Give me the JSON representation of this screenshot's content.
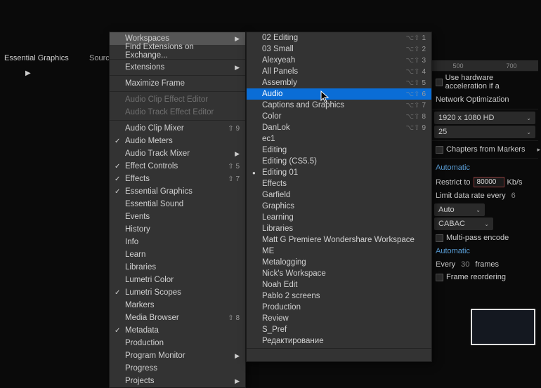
{
  "topPanel": {
    "essentialGraphics": "Essential Graphics",
    "source": "Source: (no cli"
  },
  "menu1": [
    {
      "label": "Workspaces",
      "arrow": true,
      "hl": true
    },
    {
      "label": "Find Extensions on Exchange..."
    },
    {
      "sep": true
    },
    {
      "label": "Extensions",
      "arrow": true
    },
    {
      "sep": true
    },
    {
      "label": "Maximize Frame"
    },
    {
      "sep": true
    },
    {
      "label": "Audio Clip Effect Editor",
      "dis": true
    },
    {
      "label": "Audio Track Effect Editor",
      "dis": true
    },
    {
      "sep": true
    },
    {
      "label": "Audio Clip Mixer",
      "sc": "⇧ 9"
    },
    {
      "label": "Audio Meters",
      "check": true
    },
    {
      "label": "Audio Track Mixer",
      "arrow": true
    },
    {
      "label": "Effect Controls",
      "check": true,
      "sc": "⇧ 5"
    },
    {
      "label": "Effects",
      "check": true,
      "sc": "⇧ 7"
    },
    {
      "label": "Essential Graphics",
      "check": true
    },
    {
      "label": "Essential Sound"
    },
    {
      "label": "Events"
    },
    {
      "label": "History"
    },
    {
      "label": "Info"
    },
    {
      "label": "Learn"
    },
    {
      "label": "Libraries"
    },
    {
      "label": "Lumetri Color"
    },
    {
      "label": "Lumetri Scopes",
      "check": true
    },
    {
      "label": "Markers"
    },
    {
      "label": "Media Browser",
      "sc": "⇧ 8"
    },
    {
      "label": "Metadata",
      "check": true
    },
    {
      "label": "Production"
    },
    {
      "label": "Program Monitor",
      "arrow": true
    },
    {
      "label": "Progress"
    },
    {
      "label": "Projects",
      "arrow": true
    }
  ],
  "menu2": [
    {
      "label": "02 Editing",
      "sc": "1"
    },
    {
      "label": "03 Small",
      "sc": "2"
    },
    {
      "label": "Alexyeah",
      "sc": "3"
    },
    {
      "label": "All Panels",
      "sc": "4"
    },
    {
      "label": "Assembly",
      "sc": "5"
    },
    {
      "label": "Audio",
      "sc": "6",
      "sel": true
    },
    {
      "label": "Captions and Graphics",
      "sc": "7"
    },
    {
      "label": "Color",
      "sc": "8"
    },
    {
      "label": "DanLok",
      "sc": "9"
    },
    {
      "label": "ec1"
    },
    {
      "label": "Editing"
    },
    {
      "label": "Editing (CS5.5)"
    },
    {
      "label": "Editing 01",
      "bullet": true
    },
    {
      "label": "Effects"
    },
    {
      "label": "Garfield"
    },
    {
      "label": "Graphics"
    },
    {
      "label": "Learning"
    },
    {
      "label": "Libraries"
    },
    {
      "label": "Matt G Premiere Wondershare Workspace"
    },
    {
      "label": "ME"
    },
    {
      "label": "Metalogging"
    },
    {
      "label": "Nick's Workspace"
    },
    {
      "label": "Noah Edit"
    },
    {
      "label": "Pablo 2 screens"
    },
    {
      "label": "Production"
    },
    {
      "label": "Review"
    },
    {
      "label": "S_Pref"
    },
    {
      "label": "Редактирование"
    },
    {
      "sep": true
    },
    {
      "label": ""
    }
  ],
  "scPrefix": "⌥⇧",
  "right": {
    "rulerMarks": [
      "500",
      "700"
    ],
    "hwAccel": "Use hardware acceleration if a",
    "netOpt": "Network Optimization",
    "res": "1920 x 1080 HD",
    "res2": "25",
    "chapters": "Chapters from Markers",
    "auto": "Automatic",
    "restrict": "Restrict to",
    "restrictVal": "80000",
    "kbs": "Kb/s",
    "limit": "Limit data rate every",
    "limitVal": "6",
    "dd1": "Auto",
    "dd2": "CABAC",
    "multipass": "Multi-pass encode",
    "auto2": "Automatic",
    "every": "Every",
    "everyVal": "30",
    "frames": "frames",
    "reorder": "Frame reordering"
  }
}
